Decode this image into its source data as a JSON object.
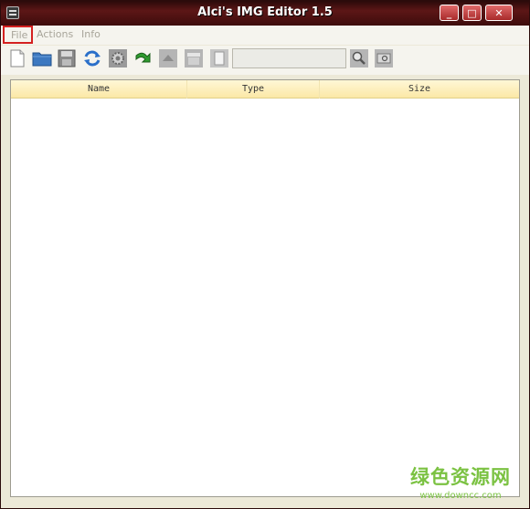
{
  "window": {
    "title": "Alci's IMG Editor 1.5",
    "controls": {
      "minimize": "_",
      "maximize": "□",
      "close": "✕"
    }
  },
  "menubar": {
    "items": [
      {
        "label": "File",
        "highlighted": true
      },
      {
        "label": "Actions"
      },
      {
        "label": "Info"
      }
    ]
  },
  "toolbar": {
    "buttons": [
      {
        "icon": "new-file-icon"
      },
      {
        "icon": "open-folder-icon"
      },
      {
        "icon": "save-icon"
      },
      {
        "icon": "refresh-icon"
      },
      {
        "icon": "settings-gear-icon"
      },
      {
        "icon": "import-arrow-icon"
      },
      {
        "icon": "export-icon"
      },
      {
        "icon": "archive-icon"
      },
      {
        "icon": "document-icon"
      }
    ],
    "search": {
      "value": "",
      "placeholder": ""
    },
    "search_buttons": [
      {
        "icon": "search-icon"
      },
      {
        "icon": "find-in-folder-icon"
      }
    ]
  },
  "table": {
    "columns": [
      "Name",
      "Type",
      "Size"
    ],
    "rows": []
  },
  "watermark": {
    "text_cn": "绿色资源网",
    "url": "www.downcc.com"
  },
  "colors": {
    "titlebar": "#4a1010",
    "header_bg": "#fbe8a6",
    "file_menu_highlight": "#d42020",
    "watermark": "#7bc242"
  }
}
